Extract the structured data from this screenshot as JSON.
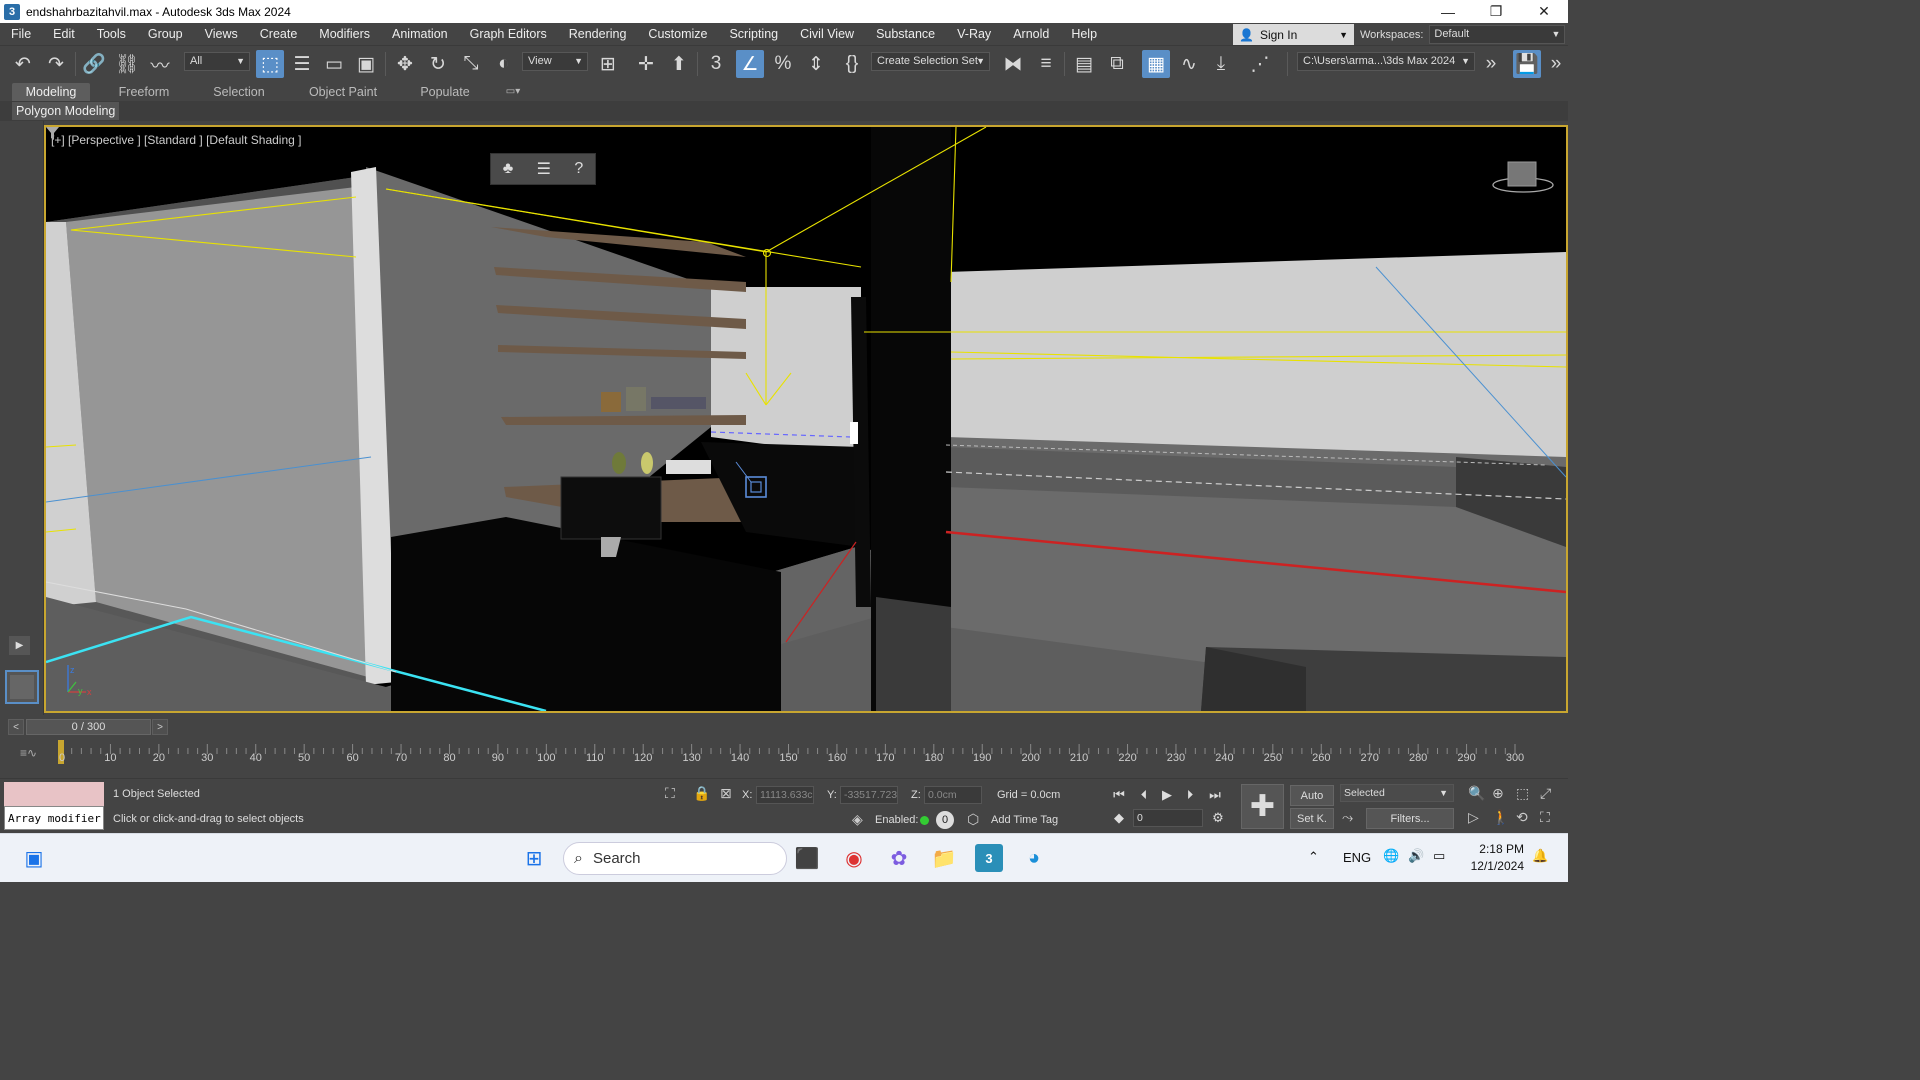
{
  "window": {
    "app_icon": "3",
    "title": "endshahrbazitahvil.max - Autodesk 3ds Max 2024",
    "minimize": "—",
    "restore": "❐",
    "close": "✕"
  },
  "menu": [
    "File",
    "Edit",
    "Tools",
    "Group",
    "Views",
    "Create",
    "Modifiers",
    "Animation",
    "Graph Editors",
    "Rendering",
    "Customize",
    "Scripting",
    "Civil View",
    "Substance",
    "V-Ray",
    "Arnold",
    "Help"
  ],
  "signin": {
    "label": "Sign In"
  },
  "workspaces": {
    "label": "Workspaces:",
    "value": "Default"
  },
  "toolbar": {
    "selection_filter": "All",
    "ref_coord": "View",
    "selection_set": "Create Selection Set",
    "project_path": "C:\\Users\\arma...\\3ds Max 2024"
  },
  "ribbon": {
    "tabs": [
      "Modeling",
      "Freeform",
      "Selection",
      "Object Paint",
      "Populate"
    ],
    "active_tab": "Modeling",
    "panel_label": "Polygon Modeling"
  },
  "viewport": {
    "label": "[+] [Perspective ] [Standard ] [Default Shading ]",
    "axis_x": "x",
    "axis_y": "y",
    "axis_z": "z"
  },
  "timeline": {
    "frame_display": "0 / 300",
    "ticks": [
      "0",
      "10",
      "20",
      "30",
      "40",
      "50",
      "60",
      "70",
      "80",
      "90",
      "100",
      "110",
      "120",
      "130",
      "140",
      "150",
      "160",
      "170",
      "180",
      "190",
      "200",
      "210",
      "220",
      "230",
      "240",
      "250",
      "260",
      "270",
      "280",
      "290",
      "300"
    ]
  },
  "status": {
    "maxscript_input": "Array modifier",
    "selection_info": "1 Object Selected",
    "prompt": "Click or click-and-drag to select objects",
    "x_label": "X:",
    "x_value": "11113.633c",
    "y_label": "Y:",
    "y_value": "-33517.723",
    "z_label": "Z:",
    "z_value": "0.0cm",
    "grid": "Grid = 0.0cm",
    "enabled_label": "Enabled:",
    "enabled_value": "0",
    "add_time_tag": "Add Time Tag",
    "auto_key": "Auto",
    "set_key": "Set K.",
    "key_filter_select": "Selected",
    "filters": "Filters...",
    "current_frame": "0"
  },
  "taskbar": {
    "search_placeholder": "Search",
    "lang": "ENG",
    "time": "2:18 PM",
    "date": "12/1/2024"
  },
  "colors": {
    "accent_blue": "#5a8fc7",
    "viewport_border": "#c8a630",
    "ui_dark": "#444444"
  }
}
